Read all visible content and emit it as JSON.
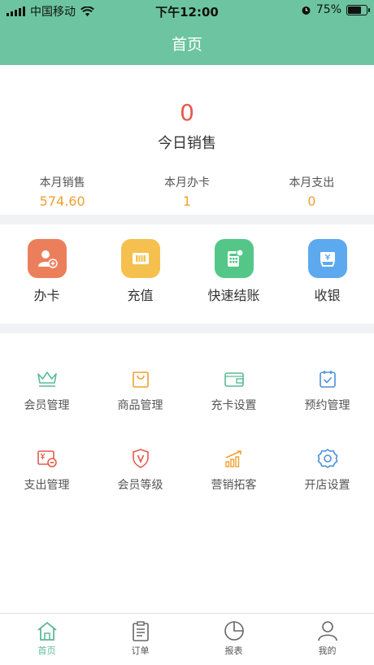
{
  "status_bar": {
    "carrier": "中国移动",
    "time": "下午12:00",
    "battery": "75%",
    "battery_level": 0.75
  },
  "header": {
    "title": "首页"
  },
  "sales": {
    "today_value": "0",
    "today_label": "今日销售",
    "stats": [
      {
        "label": "本月销售",
        "value": "574.60"
      },
      {
        "label": "本月办卡",
        "value": "1"
      },
      {
        "label": "本月支出",
        "value": "0"
      }
    ]
  },
  "quick_actions": [
    {
      "label": "办卡",
      "icon": "member-card-icon",
      "color": "#ec7f5b"
    },
    {
      "label": "充值",
      "icon": "recharge-icon",
      "color": "#f6c04f"
    },
    {
      "label": "快速结账",
      "icon": "calculator-icon",
      "color": "#54c788"
    },
    {
      "label": "收银",
      "icon": "cashier-icon",
      "color": "#5da9ef"
    }
  ],
  "grid": [
    {
      "label": "会员管理",
      "icon": "crown-icon",
      "color": "#5dbb94"
    },
    {
      "label": "商品管理",
      "icon": "shopping-bag-icon",
      "color": "#f0a030"
    },
    {
      "label": "充卡设置",
      "icon": "wallet-icon",
      "color": "#5dbb94"
    },
    {
      "label": "预约管理",
      "icon": "calendar-check-icon",
      "color": "#4a90d9"
    },
    {
      "label": "支出管理",
      "icon": "expense-icon",
      "color": "#e35a4c"
    },
    {
      "label": "会员等级",
      "icon": "shield-v-icon",
      "color": "#e35a4c"
    },
    {
      "label": "营销拓客",
      "icon": "growth-chart-icon",
      "color": "#f0a030"
    },
    {
      "label": "开店设置",
      "icon": "gear-icon",
      "color": "#4a90d9"
    }
  ],
  "tabs": [
    {
      "label": "首页",
      "icon": "home-icon",
      "active": true
    },
    {
      "label": "订单",
      "icon": "clipboard-icon",
      "active": false
    },
    {
      "label": "报表",
      "icon": "pie-chart-icon",
      "active": false
    },
    {
      "label": "我的",
      "icon": "person-icon",
      "active": false
    }
  ],
  "colors": {
    "accent": "#6cc5a0",
    "highlight": "#e35a4c",
    "stat_value": "#f0a030"
  }
}
